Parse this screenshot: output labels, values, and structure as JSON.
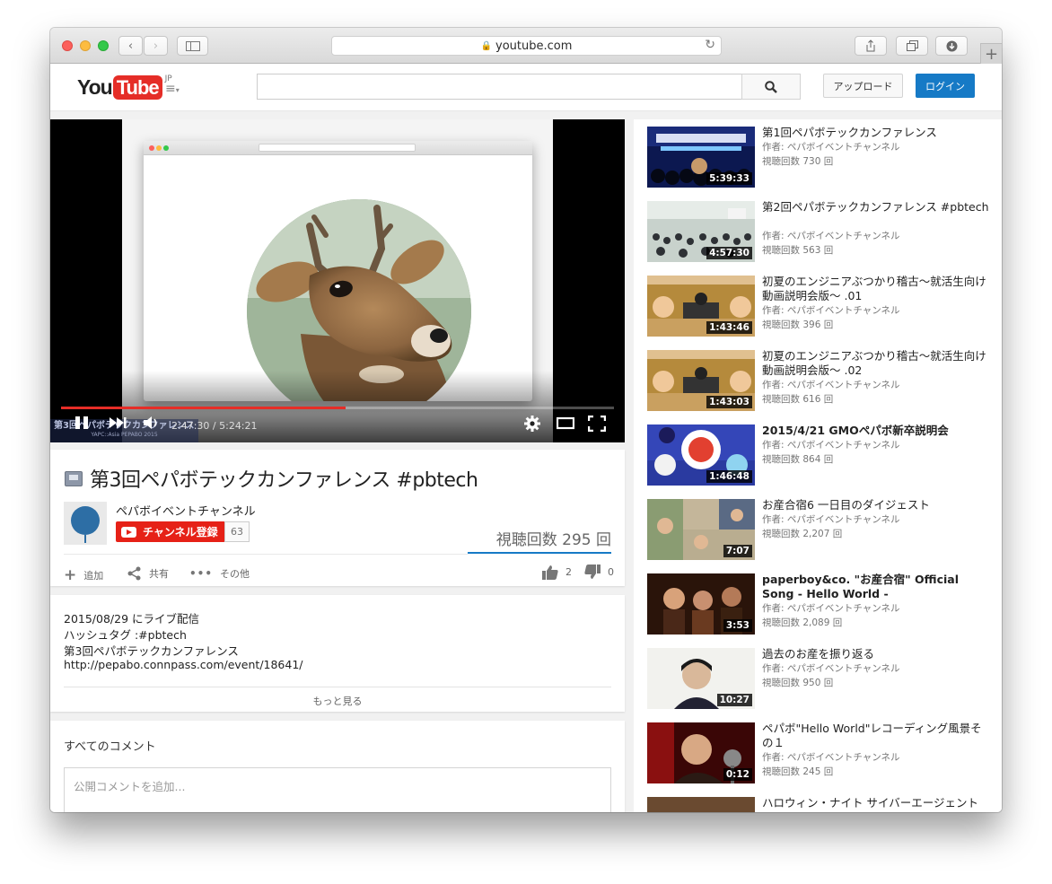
{
  "browser": {
    "url": "youtube.com"
  },
  "header": {
    "logo_you": "You",
    "logo_tube": "Tube",
    "logo_region": "JP",
    "search_placeholder": "",
    "upload_label": "アップロード",
    "login_label": "ログイン"
  },
  "player": {
    "time_current": "2:47:30",
    "time_total": "5:24:21",
    "progress_fraction": 0.515,
    "watermark_text": "第3回ペパボテックカンファレンス",
    "watermark_sub": "YAPC::Asia PEPABO 2015"
  },
  "video": {
    "title": "第3回ペパボテックカンファレンス #pbtech",
    "channel": "ペパボイベントチャンネル",
    "subscribe_label": "チャンネル登録",
    "subscriber_count": "63",
    "views": "視聴回数 295 回",
    "actions": {
      "add": "追加",
      "share": "共有",
      "more": "その他"
    },
    "likes": "2",
    "dislikes": "0"
  },
  "description": {
    "lines": [
      "2015/08/29 にライブ配信",
      "ハッシュタグ :#pbtech",
      "第3回ペパボテックカンファレンス",
      "http://pepabo.connpass.com/event/18641/"
    ],
    "more_label": "もっと見る"
  },
  "comments": {
    "heading": "すべてのコメント",
    "input_placeholder": "公開コメントを追加..."
  },
  "related": [
    {
      "title": "第1回ペパボテックカンファレンス",
      "author": "作者: ペパボイベントチャンネル",
      "views": "視聴回数 730 回",
      "duration": "5:39:33",
      "bold": false,
      "thumb": "conference-1"
    },
    {
      "title": "第2回ペパボテックカンファレンス #pbtech",
      "author": "作者: ペパボイベントチャンネル",
      "views": "視聴回数 563 回",
      "duration": "4:57:30",
      "bold": false,
      "thumb": "audience"
    },
    {
      "title": "初夏のエンジニアぶつかり稽古〜就活生向け動画説明会版〜 .01",
      "author": "作者: ペパボイベントチャンネル",
      "views": "視聴回数 396 回",
      "duration": "1:43:46",
      "bold": false,
      "thumb": "sumo-1"
    },
    {
      "title": "初夏のエンジニアぶつかり稽古〜就活生向け動画説明会版〜 .02",
      "author": "作者: ペパボイベントチャンネル",
      "views": "視聴回数 616 回",
      "duration": "1:43:03",
      "bold": false,
      "thumb": "sumo-2"
    },
    {
      "title": "2015/4/21 GMOペパボ新卒説明会",
      "author": "作者: ペパボイベントチャンネル",
      "views": "視聴回数 864 回",
      "duration": "1:46:48",
      "bold": true,
      "thumb": "recruit"
    },
    {
      "title": "お産合宿6 一日目のダイジェスト",
      "author": "作者: ペパボイベントチャンネル",
      "views": "視聴回数 2,207 回",
      "duration": "7:07",
      "bold": false,
      "thumb": "camp"
    },
    {
      "title": "paperboy&co. \"お産合宿\" Official Song - Hello World -",
      "author": "作者: ペパボイベントチャンネル",
      "views": "視聴回数 2,089 回",
      "duration": "3:53",
      "bold": true,
      "thumb": "song"
    },
    {
      "title": "過去のお産を振り返る",
      "author": "作者: ペパボイベントチャンネル",
      "views": "視聴回数 950 回",
      "duration": "10:27",
      "bold": false,
      "thumb": "portrait"
    },
    {
      "title": "ペパボ\"Hello World\"レコーディング風景その１",
      "author": "作者: ペパボイベントチャンネル",
      "views": "視聴回数 245 回",
      "duration": "0:12",
      "bold": false,
      "thumb": "recording"
    },
    {
      "title": "ハロウィン・ナイト サイバーエージェント",
      "author": "",
      "views": "",
      "duration": "",
      "bold": false,
      "thumb": "halloween"
    }
  ],
  "colors": {
    "brand_red": "#e52d27",
    "login_blue": "#167ac6",
    "subscribe_red": "#e62117"
  }
}
